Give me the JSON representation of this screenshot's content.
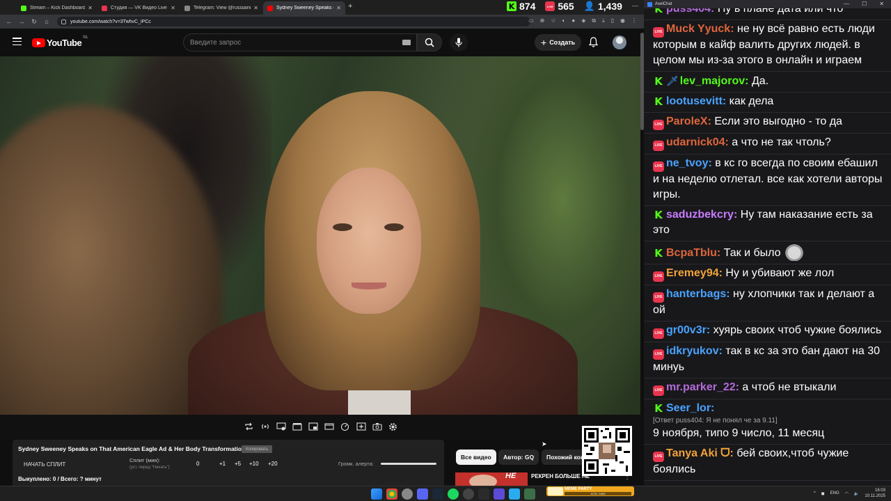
{
  "browser": {
    "tabs": [
      {
        "label": "Stream – Kick Dashboard",
        "favicon_color": "#53fc18",
        "active": false
      },
      {
        "label": "Студия — VK Видео Live",
        "favicon_color": "#e8344d",
        "active": false
      },
      {
        "label": "Telegram: View @russiainmyme",
        "favicon_color": "#888888",
        "active": false
      },
      {
        "label": "Sydney Sweeney Speaks on Tha",
        "favicon_color": "#ff0000",
        "active": true
      }
    ],
    "new_tab": "+",
    "url": "youtube.com/watch?v=3TwhvC_iPCc"
  },
  "stream_stats": {
    "kick_viewers": "874",
    "vk_viewers": "565",
    "total_viewers": "1,439"
  },
  "youtube": {
    "logo_text": "YouTube",
    "country_code": "NL",
    "search_placeholder": "Введите запрос",
    "create_label": "Создать"
  },
  "split_panel": {
    "video_title": "Sydney Sweeney Speaks on That American Eagle Ad & Her Body Transformation",
    "copy_label": "Копировать",
    "start_split": "НАЧАТЬ СПЛИТ",
    "split_label": "Сплит (мин):",
    "split_hint": "(уст. перед \"Начать\")",
    "split_value": "0",
    "increments": [
      "+1",
      "+5",
      "+10",
      "+20"
    ],
    "volume_label": "Громк. алерта:",
    "killed": "Выкуплено: 0 / Всего: ? минут"
  },
  "chips": {
    "all": "Все видео",
    "author": "Автор: GQ",
    "similar": "Похожий кон"
  },
  "recommendation": {
    "title": "РЕКРЕН БОЛЬШЕ НЕ",
    "thumb_text": "НЕ"
  },
  "chat": {
    "window_title": "AxelChat",
    "messages": [
      {
        "platform": "kick",
        "user": "puss404",
        "color": "#b46ad9",
        "text": "Ну в плане дата или что"
      },
      {
        "platform": "vk",
        "user": "Muck Yyuck",
        "color": "#e0663b",
        "text": "не ну всё равно есть люди которым в кайф валить других людей. в целом мы из-за этого в онлайн и играем"
      },
      {
        "platform": "kick",
        "user": "lev_majorov",
        "color": "#53fc18",
        "icon": "sword-icon",
        "text": "Да."
      },
      {
        "platform": "kick",
        "user": "lootusevitt",
        "color": "#4aa3ff",
        "text": "как дела"
      },
      {
        "platform": "vk",
        "user": "ParoleX",
        "color": "#e0663b",
        "text": "Если это выгодно - то да"
      },
      {
        "platform": "vk",
        "user": "udarnick04",
        "color": "#e0663b",
        "text": "а что не так чтоль?"
      },
      {
        "platform": "vk",
        "user": "ne_tvoy",
        "color": "#4aa3ff",
        "text": "в кс го всегда по своим ебашил и на неделю отлетал. все как хотели авторы игры."
      },
      {
        "platform": "kick",
        "user": "saduzbekcry",
        "color": "#c77dff",
        "text": "Ну там наказание есть за это"
      },
      {
        "platform": "kick",
        "user": "BcpaTblu",
        "color": "#e0663b",
        "text": "Так и было",
        "emote": "cat-emote"
      },
      {
        "platform": "vk",
        "user": "Eremey94",
        "color": "#f2a33a",
        "text": "Ну и убивают же лол"
      },
      {
        "platform": "vk",
        "user": "hanterbags",
        "color": "#4aa3ff",
        "text": "ну хлопчики так и делают а ой"
      },
      {
        "platform": "vk",
        "user": "gr00v3r",
        "color": "#4aa3ff",
        "text": "хуярь своих чтоб чужие боялись"
      },
      {
        "platform": "vk",
        "user": "idkryukov",
        "color": "#4aa3ff",
        "text": "так в кс за это бан дают на 30 минуь"
      },
      {
        "platform": "vk",
        "user": "mr.parker_22",
        "color": "#b46ad9",
        "text": "а чтоб не втыкали"
      },
      {
        "platform": "kick",
        "user": "Seer_lor",
        "color": "#4aa3ff",
        "reply": "[Ответ puss404: Я не понял че за 9.11]",
        "text": "9 ноября, типо 9 число, 11 месяц",
        "text_only_line": true
      },
      {
        "platform": "vk",
        "user": "Tanya Aki ᗜ",
        "color": "#f2a33a",
        "text": "бей своих,чтоб чужие боялись"
      }
    ]
  },
  "taskbar": {
    "widget_title": "МЕМЕ PARTY",
    "widget_progress": "1275 / 1500",
    "language": "ENG",
    "time": "16:03",
    "date": "10.11.2025"
  }
}
